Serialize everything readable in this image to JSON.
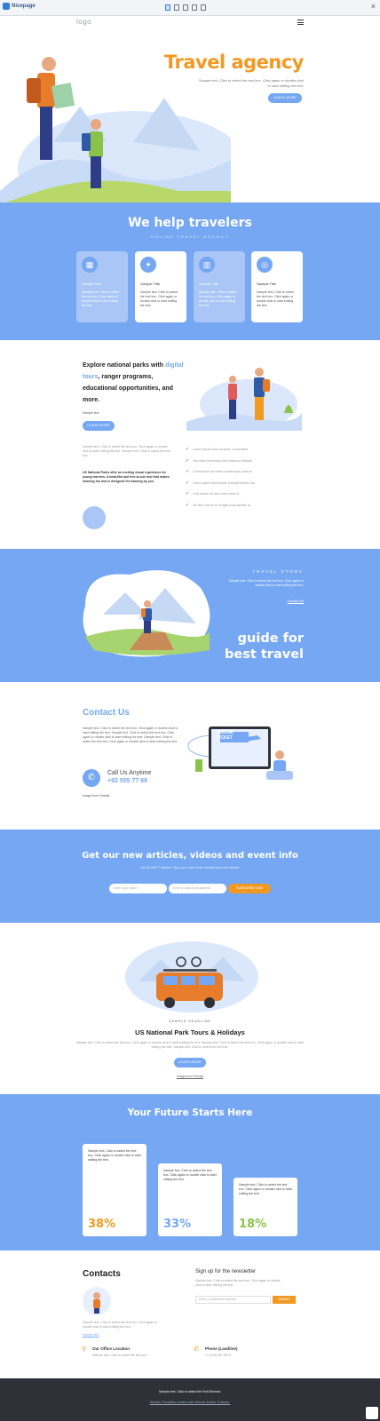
{
  "toolbar": {
    "brand": "Nicepage",
    "close": "×"
  },
  "nav": {
    "logo": "logo",
    "menu_icon": "hamburger-icon"
  },
  "hero": {
    "title": "Travel agency",
    "subtitle": "Sample text. Click to select the text box. Click again or double click to start editing the text.",
    "button": "LEARN MORE"
  },
  "help": {
    "title": "We help travelers",
    "subtitle": "ONLINE TRAVEL AGENCY",
    "cards": [
      {
        "icon": "map-icon",
        "title": "Sample Title",
        "text": "Sample text. Click to select the text box. Click again or double click to start editing the text."
      },
      {
        "icon": "compass-icon",
        "title": "Sample Title",
        "text": "Sample text. Click to select the text box. Click again or double click to start editing the text."
      },
      {
        "icon": "chart-icon",
        "title": "Sample Title",
        "text": "Sample text. Click to select the text box. Click again or double click to start editing the text."
      },
      {
        "icon": "globe-icon",
        "title": "Sample Title",
        "text": "Sample text. Click to select the text box. Click again or double click to start editing the text."
      }
    ]
  },
  "explore": {
    "heading_1": "Explore national parks with",
    "heading_link": "digital tours",
    "heading_2": ", ranger programs, educational opportunities, and more.",
    "small": "Sample text",
    "button": "LEARN MORE",
    "para": "Sample text. Click to select the text box. Click again or double click to start editing the text. Sample text. Click to select the text box.",
    "bold": "US National Parks offer an exciting visual experience for young learners. A beautiful and free-to-use tool that makes learning fun and is designed for learning by you.",
    "checks": [
      "Lorem ipsum dolor sit amet, consectetur",
      "Sed diam nonummy nibh euismod tincidunt",
      "Ut wisi enim ad minim veniam quis nostrud",
      "Exerci tation ullamcorper suscipit lobortis nisl",
      "Duis autem vel eum iriure dolor in",
      "Vel illum dolore eu feugiat nulla facilisis at"
    ]
  },
  "story": {
    "label": "TRAVEL STORY",
    "text": "Sample text. Click to select the text box. Click again or double click to start editing the text.",
    "link": "Sample text",
    "title_1": "guide for",
    "title_2": "best travel"
  },
  "contact": {
    "title": "Contact Us",
    "text": "Sample text. Click to select the text box. Click again or double click to start editing the text. Sample text. Click to select the text box. Click again or double click to start editing the text. Sample text. Click to select the text box. Click again or double click to start editing the text.",
    "call_label": "Call Us Anytime",
    "phone": "+92 555 77 88",
    "image_note": "Image from Freepik",
    "ticket_text": "ONLINE TICKET"
  },
  "newsletter": {
    "title": "Get our new articles, videos and event info",
    "sub": "Join 40,000+ Travelers. Stay up to date on the newest news and articles.",
    "name_placeholder": "Enter your Name",
    "email_placeholder": "Enter a valid email address",
    "button": "SUBSCRIBE NOW"
  },
  "tours": {
    "label": "SAMPLE HEADLINE",
    "title": "US National Park Tours & Holidays",
    "text": "Sample text. Click to select the text box. Click again or double click to start editing the text. Sample text. Click to select the text box. Click again or double click to start editing the text. Sample text. Click to select the text box.",
    "button": "LEARN MORE",
    "note": "Image from Freepik"
  },
  "future": {
    "title": "Your Future Starts Here",
    "stats": [
      {
        "text": "Sample text. Click to select the text box. Click again or double click to start editing the text.",
        "value": "38%",
        "color": "#f09a23"
      },
      {
        "text": "Sample text. Click to select the text box. Click again or double click to start editing the text.",
        "value": "33%",
        "color": "#76a7f2"
      },
      {
        "text": "Sample text. Click to select the text box. Click again or double click to start editing the text.",
        "value": "18%",
        "color": "#8bc34a"
      }
    ]
  },
  "contacts": {
    "title": "Contacts",
    "text": "Sample text. Click to select the text box. Click again or double click to start editing the text.",
    "link": "Sample text",
    "signup_title": "Sign up for the newsletter",
    "signup_text": "Sample text. Click to select the text box. Click again or double click to start editing the text.",
    "email_placeholder": "Enter a valid email address",
    "submit": "SUBMIT",
    "office_label": "Our Office Location",
    "office_text": "Sample text. Click to select the text box.",
    "phone_label": "Phone (Landline)",
    "phone_text": "+1 (234) 567-8910"
  },
  "footer": {
    "line1": "Sample text. Click to select the Text Element.",
    "line2": "Website Templates created with Website Builder Software."
  },
  "colors": {
    "accent": "#76a7f2",
    "orange": "#f09a23",
    "dark": "#2e3138"
  }
}
